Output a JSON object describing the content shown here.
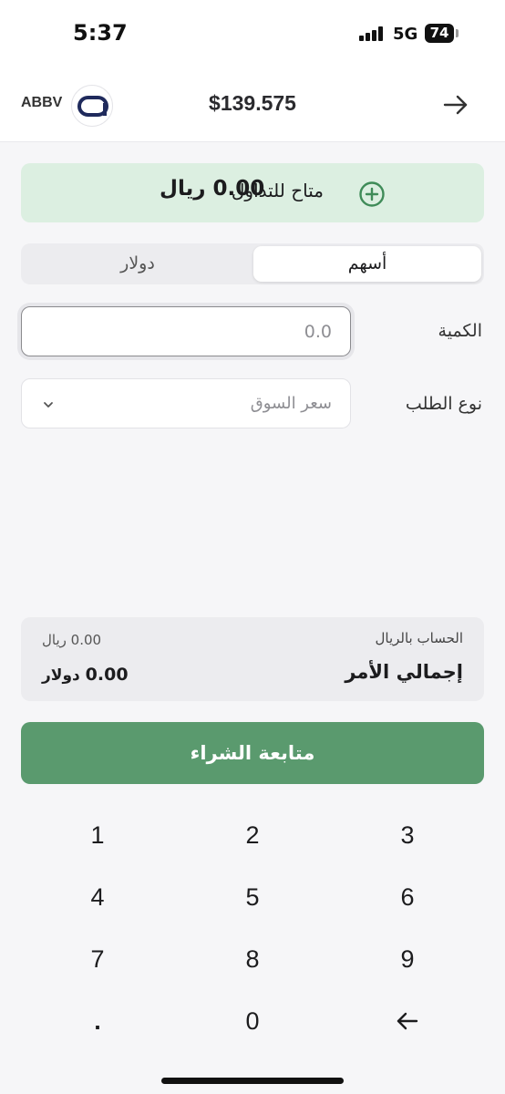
{
  "status_bar": {
    "time": "5:37",
    "network": "5G",
    "battery": "74"
  },
  "header": {
    "ticker": "ABBV",
    "price": "$139.575",
    "logo_letter": "a"
  },
  "available": {
    "label": "متاح للتداول",
    "amount": "0.00 ريال"
  },
  "segment": {
    "shares_label": "أسهم",
    "dollars_label": "دولار",
    "selected": "أسهم"
  },
  "quantity": {
    "label": "الكمية",
    "placeholder": "0.0"
  },
  "order_type": {
    "label": "نوع الطلب",
    "value": "سعر السوق"
  },
  "summary": {
    "account_label": "الحساب بالريال",
    "total_label": "إجمالي الأمر",
    "sar_value": "0.00 ريال",
    "usd_amount": "0.00",
    "usd_unit": "دولار"
  },
  "buy_button": {
    "label": "متابعة الشراء"
  },
  "keypad": {
    "keys": [
      "1",
      "2",
      "3",
      "4",
      "5",
      "6",
      "7",
      "8",
      "9",
      ".",
      "0"
    ]
  },
  "colors": {
    "accent_green": "#5a9a6e",
    "available_bg": "#dcefe1",
    "logo_navy": "#1f2a5c"
  }
}
